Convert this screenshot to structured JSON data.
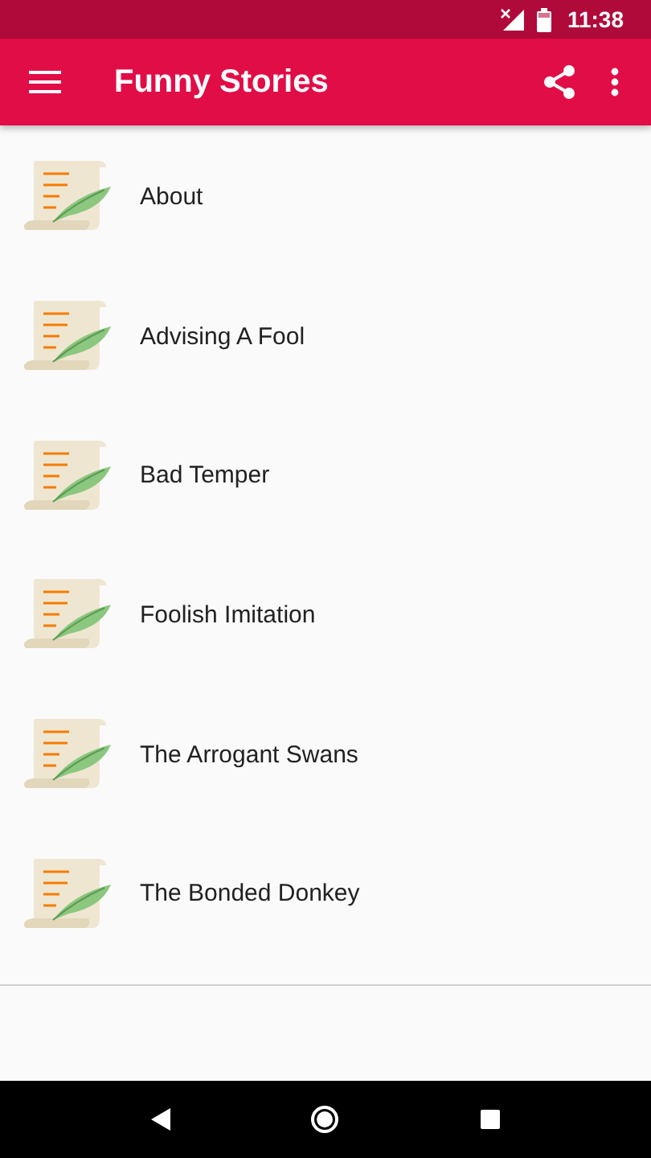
{
  "status_bar": {
    "time": "11:38"
  },
  "app_bar": {
    "title": "Funny Stories"
  },
  "stories": [
    {
      "title": "About"
    },
    {
      "title": "Advising A Fool"
    },
    {
      "title": "Bad Temper"
    },
    {
      "title": "Foolish Imitation"
    },
    {
      "title": "The Arrogant Swans"
    },
    {
      "title": "The Bonded Donkey"
    }
  ]
}
